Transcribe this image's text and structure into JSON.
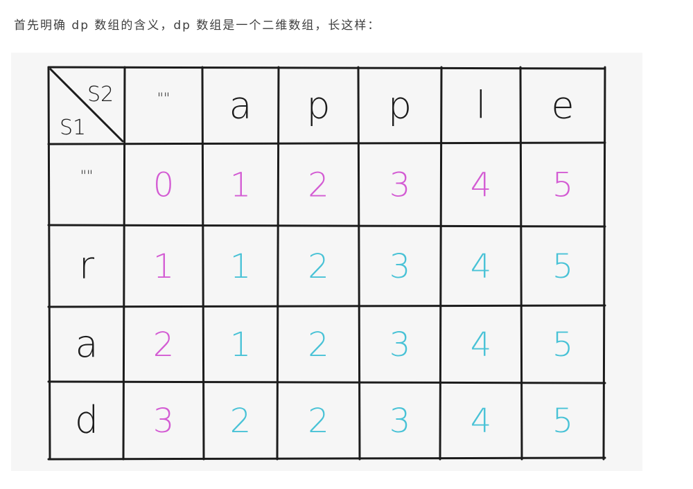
{
  "intro_text": "首先明确 dp 数组的含义，dp 数组是一个二维数组，长这样：",
  "table": {
    "corner": {
      "top_right": "S2",
      "bottom_left": "S1"
    },
    "column_headers": [
      "\"\"",
      "a",
      "p",
      "p",
      "l",
      "e"
    ],
    "row_headers": [
      "\"\"",
      "r",
      "a",
      "d"
    ],
    "cells": [
      [
        0,
        1,
        2,
        3,
        4,
        5
      ],
      [
        1,
        1,
        2,
        3,
        4,
        5
      ],
      [
        2,
        1,
        2,
        3,
        4,
        5
      ],
      [
        3,
        2,
        2,
        3,
        4,
        5
      ]
    ],
    "colors": {
      "pink": "#d35bd3",
      "cyan": "#48c2d6",
      "ink": "#1c1c1c",
      "background": "#f6f6f6"
    },
    "cell_color_keys": [
      [
        "pink",
        "pink",
        "pink",
        "pink",
        "pink",
        "pink"
      ],
      [
        "pink",
        "cyan",
        "cyan",
        "cyan",
        "cyan",
        "cyan"
      ],
      [
        "pink",
        "cyan",
        "cyan",
        "cyan",
        "cyan",
        "cyan"
      ],
      [
        "pink",
        "cyan",
        "cyan",
        "cyan",
        "cyan",
        "cyan"
      ]
    ]
  }
}
